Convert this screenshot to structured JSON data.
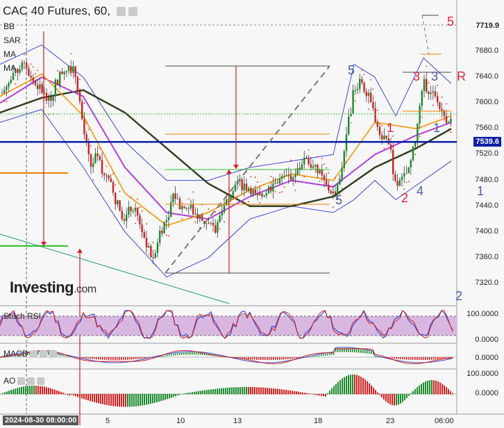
{
  "header": {
    "title": "CAC 40 Futures, 60,"
  },
  "indicators": {
    "overlay": [
      "BB",
      "SAR",
      "MA",
      "MA"
    ],
    "stoch": "Stoch RSI",
    "macd": "MACD",
    "ao": "AO"
  },
  "branding": {
    "logo": "Investing",
    "logo_suffix": ".com"
  },
  "colors": {
    "bull": "#1a8a2a",
    "bear": "#d02020",
    "price_line": "#0a1ea8",
    "bb": "#3a4ad8",
    "ma_fast": "#f0a020",
    "ma_mid": "#b040d8",
    "ma_slow": "#304020",
    "wave_red": "#e0203a",
    "wave_blue": "#4a5aa8"
  },
  "chart_data": [
    {
      "panel": "price",
      "type": "candlestick",
      "title": "CAC 40 Futures, 60,",
      "y_axis": {
        "ticks": [
          "7680.0",
          "7640.0",
          "7600.0",
          "7560.0",
          "7520.0",
          "7480.0",
          "7440.0",
          "7400.0",
          "7360.0",
          "7320.0"
        ],
        "range": [
          7300,
          7730
        ]
      },
      "labels": {
        "price_current": "7539.6",
        "price_top": "7719.9"
      },
      "x_ticks": [
        "5",
        "10",
        "13",
        "18",
        "23",
        "06:00"
      ],
      "date_label": "2024-08-30 08:00:00",
      "close_path": [
        [
          0,
          7610
        ],
        [
          10,
          7628
        ],
        [
          20,
          7640
        ],
        [
          30,
          7660
        ],
        [
          40,
          7650
        ],
        [
          50,
          7630
        ],
        [
          60,
          7620
        ],
        [
          70,
          7600
        ],
        [
          80,
          7630
        ],
        [
          90,
          7650
        ],
        [
          100,
          7660
        ],
        [
          110,
          7640
        ],
        [
          120,
          7560
        ],
        [
          130,
          7500
        ],
        [
          140,
          7520
        ],
        [
          150,
          7490
        ],
        [
          160,
          7470
        ],
        [
          170,
          7440
        ],
        [
          180,
          7420
        ],
        [
          190,
          7440
        ],
        [
          200,
          7420
        ],
        [
          210,
          7380
        ],
        [
          220,
          7360
        ],
        [
          230,
          7400
        ],
        [
          240,
          7420
        ],
        [
          250,
          7460
        ],
        [
          260,
          7440
        ],
        [
          270,
          7440
        ],
        [
          280,
          7430
        ],
        [
          290,
          7420
        ],
        [
          300,
          7410
        ],
        [
          310,
          7400
        ],
        [
          320,
          7440
        ],
        [
          330,
          7460
        ],
        [
          340,
          7480
        ],
        [
          350,
          7470
        ],
        [
          360,
          7470
        ],
        [
          370,
          7450
        ],
        [
          380,
          7460
        ],
        [
          390,
          7470
        ],
        [
          400,
          7480
        ],
        [
          410,
          7480
        ],
        [
          420,
          7490
        ],
        [
          430,
          7500
        ],
        [
          440,
          7520
        ],
        [
          450,
          7500
        ],
        [
          460,
          7490
        ],
        [
          470,
          7470
        ],
        [
          480,
          7460
        ],
        [
          490,
          7480
        ],
        [
          500,
          7560
        ],
        [
          510,
          7620
        ],
        [
          520,
          7640
        ],
        [
          530,
          7610
        ],
        [
          540,
          7580
        ],
        [
          550,
          7550
        ],
        [
          560,
          7540
        ],
        [
          570,
          7470
        ],
        [
          580,
          7480
        ],
        [
          590,
          7500
        ],
        [
          600,
          7550
        ],
        [
          610,
          7630
        ],
        [
          620,
          7620
        ],
        [
          630,
          7600
        ],
        [
          640,
          7580
        ],
        [
          650,
          7570
        ]
      ],
      "overlays": {
        "sma_slow_path": [
          [
            0,
            7585
          ],
          [
            60,
            7608
          ],
          [
            120,
            7620
          ],
          [
            180,
            7585
          ],
          [
            240,
            7530
          ],
          [
            300,
            7475
          ],
          [
            360,
            7440
          ],
          [
            420,
            7440
          ],
          [
            480,
            7455
          ],
          [
            540,
            7500
          ],
          [
            600,
            7530
          ],
          [
            650,
            7560
          ]
        ],
        "ma_mid_path": [
          [
            0,
            7600
          ],
          [
            60,
            7640
          ],
          [
            120,
            7610
          ],
          [
            180,
            7500
          ],
          [
            240,
            7430
          ],
          [
            300,
            7420
          ],
          [
            360,
            7455
          ],
          [
            420,
            7480
          ],
          [
            480,
            7470
          ],
          [
            540,
            7520
          ],
          [
            600,
            7550
          ],
          [
            650,
            7570
          ]
        ],
        "ma_fast_path": [
          [
            0,
            7610
          ],
          [
            60,
            7645
          ],
          [
            120,
            7580
          ],
          [
            180,
            7460
          ],
          [
            240,
            7410
          ],
          [
            300,
            7430
          ],
          [
            360,
            7465
          ],
          [
            420,
            7490
          ],
          [
            480,
            7480
          ],
          [
            540,
            7570
          ],
          [
            600,
            7560
          ],
          [
            650,
            7580
          ]
        ],
        "bb_upper_path": [
          [
            0,
            7660
          ],
          [
            60,
            7690
          ],
          [
            120,
            7640
          ],
          [
            180,
            7540
          ],
          [
            240,
            7480
          ],
          [
            300,
            7480
          ],
          [
            360,
            7500
          ],
          [
            420,
            7510
          ],
          [
            480,
            7520
          ],
          [
            510,
            7660
          ],
          [
            540,
            7640
          ],
          [
            570,
            7580
          ],
          [
            610,
            7670
          ],
          [
            650,
            7630
          ]
        ],
        "bb_lower_path": [
          [
            0,
            7570
          ],
          [
            60,
            7590
          ],
          [
            120,
            7500
          ],
          [
            180,
            7400
          ],
          [
            240,
            7330
          ],
          [
            300,
            7360
          ],
          [
            360,
            7420
          ],
          [
            420,
            7440
          ],
          [
            480,
            7430
          ],
          [
            510,
            7450
          ],
          [
            540,
            7480
          ],
          [
            570,
            7450
          ],
          [
            610,
            7480
          ],
          [
            650,
            7510
          ]
        ]
      },
      "wave_labels": [
        {
          "text": "5",
          "color": "red",
          "x": 650,
          "price": 7725
        },
        {
          "text": "R",
          "color": "red",
          "x": 664,
          "price": 7640
        },
        {
          "text": "3",
          "color": "red",
          "x": 601,
          "price": 7640
        },
        {
          "text": "3",
          "color": "blue",
          "x": 627,
          "price": 7640
        },
        {
          "text": "1",
          "color": "red",
          "x": 563,
          "price": 7560
        },
        {
          "text": "1",
          "color": "blue",
          "x": 630,
          "price": 7560
        },
        {
          "text": "2",
          "color": "red",
          "x": 584,
          "price": 7452
        },
        {
          "text": "4",
          "color": "blue",
          "x": 606,
          "price": 7462
        },
        {
          "text": "5",
          "color": "blue",
          "x": 507,
          "price": 7650
        },
        {
          "text": "5",
          "color": "blue",
          "x": 489,
          "price": 7448
        },
        {
          "text": "1",
          "color": "blue",
          "x": 693,
          "price": 7462
        },
        {
          "text": "2",
          "color": "blue",
          "x": 662,
          "price": 7300
        }
      ]
    },
    {
      "panel": "stoch_rsi",
      "type": "line",
      "title": "Stoch RSI",
      "y_ticks": [
        "100.0000",
        "0.0000"
      ],
      "range": [
        0,
        100
      ]
    },
    {
      "panel": "macd",
      "type": "line",
      "title": "MACD",
      "y_ticks": [
        "0.0000"
      ]
    },
    {
      "panel": "ao",
      "type": "bar",
      "title": "AO",
      "y_ticks": [
        "100.0000",
        "0.0000"
      ]
    }
  ]
}
